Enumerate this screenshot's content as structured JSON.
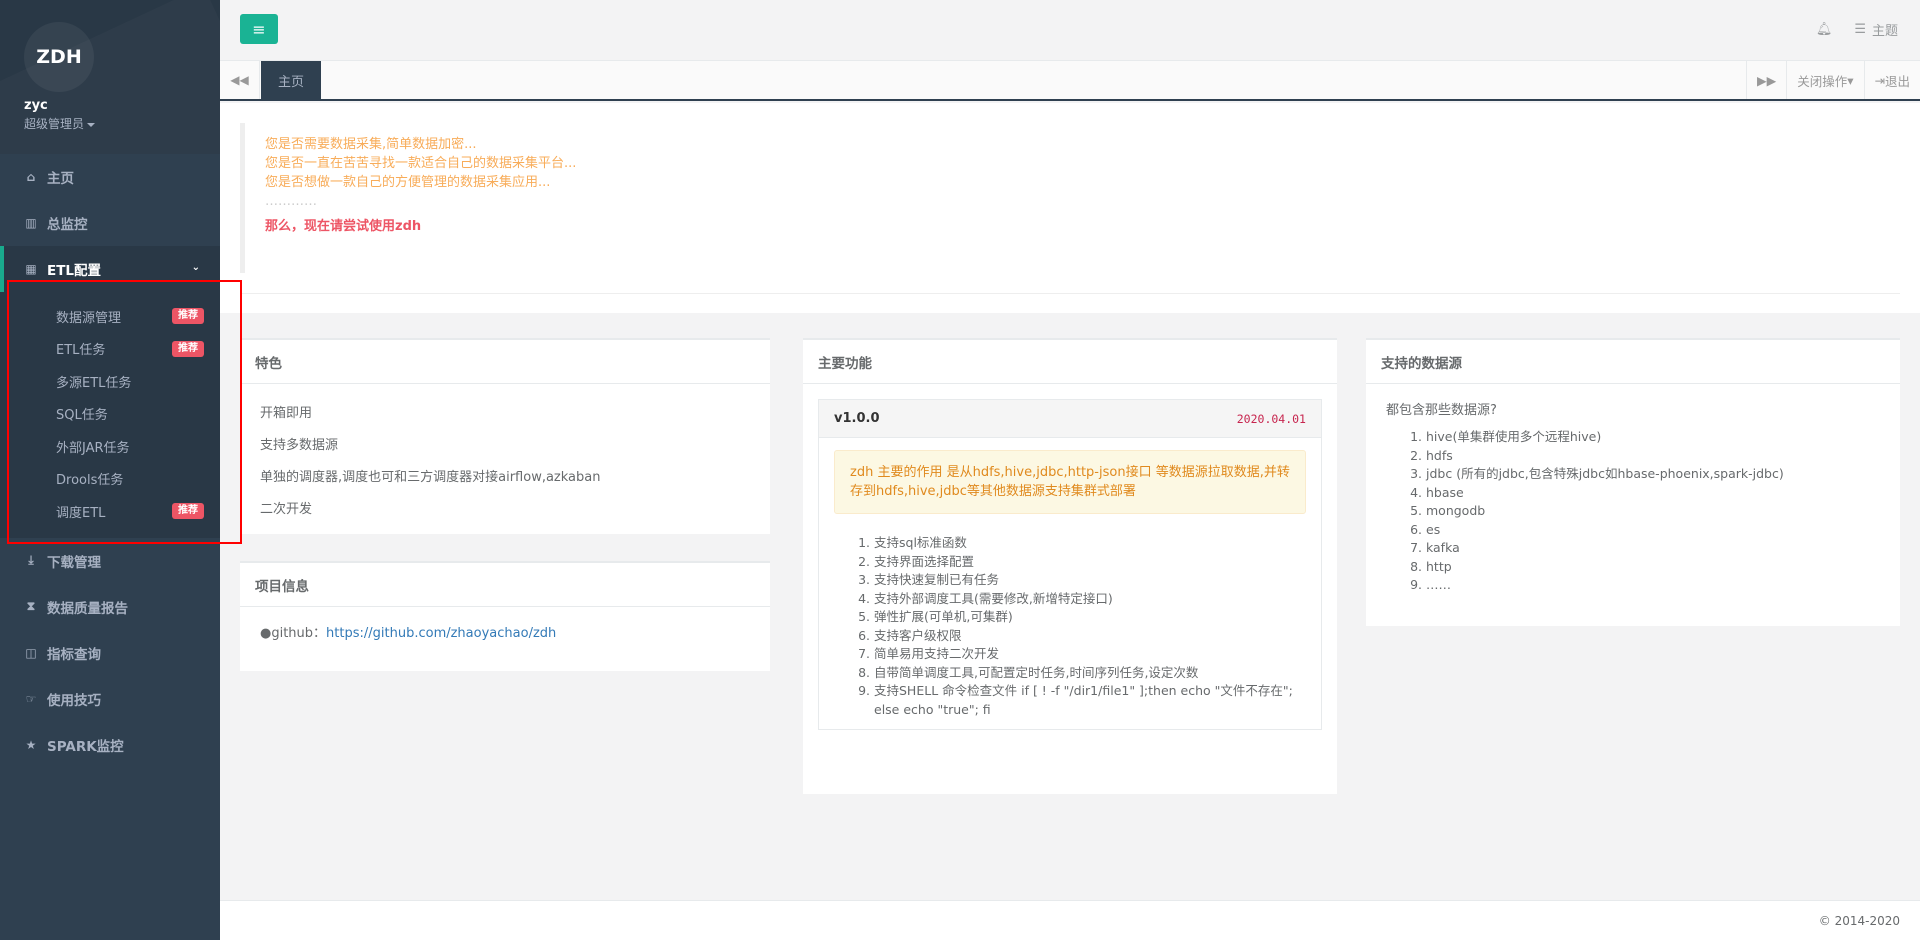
{
  "sidebar": {
    "logo": "ZDH",
    "user_name": "zyc",
    "user_role": "超级管理员",
    "items": [
      {
        "label": "主页",
        "icon": "home-icon"
      },
      {
        "label": "总监控",
        "icon": "bar-chart-icon"
      },
      {
        "label": "ETL配置",
        "icon": "table-icon"
      },
      {
        "label": "下载管理",
        "icon": "download-icon"
      },
      {
        "label": "数据质量报告",
        "icon": "hourglass-icon"
      },
      {
        "label": "指标查询",
        "icon": "columns-icon"
      },
      {
        "label": "使用技巧",
        "icon": "hand-icon"
      },
      {
        "label": "SPARK监控",
        "icon": "star-icon"
      }
    ],
    "etl_sub": [
      {
        "label": "数据源管理",
        "badge": "推荐"
      },
      {
        "label": "ETL任务",
        "badge": "推荐"
      },
      {
        "label": "多源ETL任务",
        "badge": ""
      },
      {
        "label": "SQL任务",
        "badge": ""
      },
      {
        "label": "外部JAR任务",
        "badge": ""
      },
      {
        "label": "Drools任务",
        "badge": ""
      },
      {
        "label": "调度ETL",
        "badge": "推荐"
      }
    ]
  },
  "topbar": {
    "theme_label": "主题"
  },
  "tabs": {
    "home": "主页",
    "close_ops": "关闭操作",
    "logout": "退出"
  },
  "intro": {
    "line1": "您是否需要数据采集,简单数据加密...",
    "line2": "您是否一直在苦苦寻找一款适合自己的数据采集平台...",
    "line3": "您是否想做一款自己的方便管理的数据采集应用...",
    "line4": "…………",
    "highlight": "那么，现在请尝试使用zdh"
  },
  "features": {
    "title": "特色",
    "items": [
      "开箱即用",
      "支持多数据源",
      "单独的调度器,调度也可和三方调度器对接airflow,azkaban",
      "二次开发"
    ]
  },
  "project": {
    "title": "项目信息",
    "github_label": "github：",
    "github_url": "https://github.com/zhaoyachao/zdh"
  },
  "main_features": {
    "title": "主要功能",
    "version": "v1.0.0",
    "date": "2020.04.01",
    "alert": "zdh 主要的作用 是从hdfs,hive,jdbc,http-json接口 等数据源拉取数据,并转存到hdfs,hive,jdbc等其他数据源支持集群式部署",
    "items": [
      "支持sql标准函数",
      "支持界面选择配置",
      "支持快速复制已有任务",
      "支持外部调度工具(需要修改,新增特定接口)",
      "弹性扩展(可单机,可集群)",
      "支持客户级权限",
      "简单易用支持二次开发",
      "自带简单调度工具,可配置定时任务,时间序列任务,设定次数",
      "支持SHELL 命令检查文件 if [ ! -f \"/dir1/file1\" ];then echo \"文件不存在\"; else echo \"true\"; fi"
    ]
  },
  "datasources": {
    "title": "支持的数据源",
    "intro": "都包含那些数据源?",
    "items": [
      "hive(单集群使用多个远程hive)",
      "hdfs",
      "jdbc (所有的jdbc,包含特殊jdbc如hbase-phoenix,spark-jdbc)",
      "hbase",
      "mongodb",
      "es",
      "kafka",
      "http",
      "……"
    ]
  },
  "footer": "© 2014-2020",
  "colors": {
    "sidebar_bg": "#2f4050",
    "accent": "#1ab394",
    "badge": "#ed5565",
    "warning_text": "#f8ac59"
  }
}
